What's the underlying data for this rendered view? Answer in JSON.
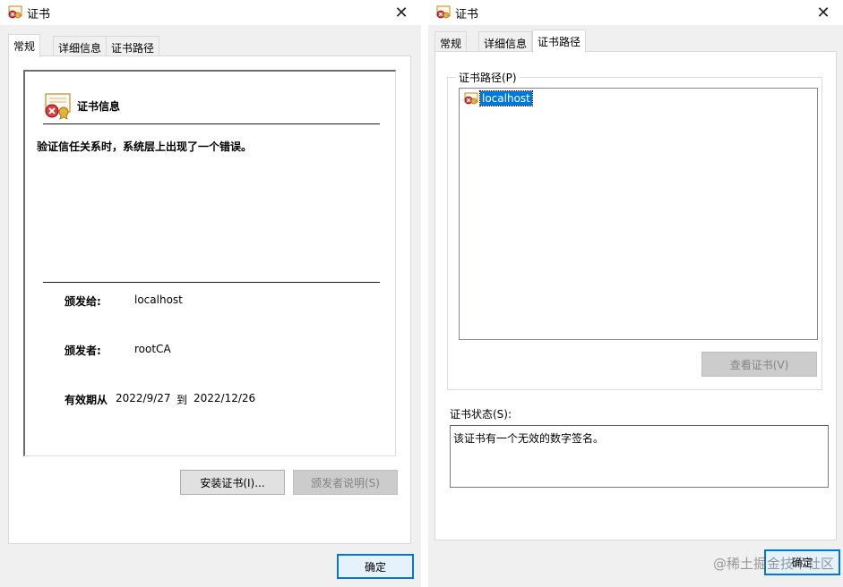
{
  "left": {
    "title": "证书",
    "tabs": [
      "常规",
      "详细信息",
      "证书路径"
    ],
    "info_title": "证书信息",
    "error_message": "验证信任关系时，系统层上出现了一个错误。",
    "issued_to_label": "颁发给:",
    "issued_to_value": "localhost",
    "issued_by_label": "颁发者:",
    "issued_by_value": "rootCA",
    "validity_label": "有效期从",
    "valid_from": "2022/9/27",
    "to_label": "到",
    "valid_to": "2022/12/26",
    "install_button": "安装证书(I)...",
    "issuer_statement_button": "颁发者说明(S)",
    "ok_button": "确定"
  },
  "right": {
    "title": "证书",
    "tabs": [
      "常规",
      "详细信息",
      "证书路径"
    ],
    "path_group_label": "证书路径(P)",
    "path_items": [
      "localhost"
    ],
    "view_cert_button": "查看证书(V)",
    "status_label": "证书状态(S):",
    "status_text": "该证书有一个无效的数字签名。",
    "ok_button": "确定"
  },
  "watermark": "@稀土掘金技术社区"
}
